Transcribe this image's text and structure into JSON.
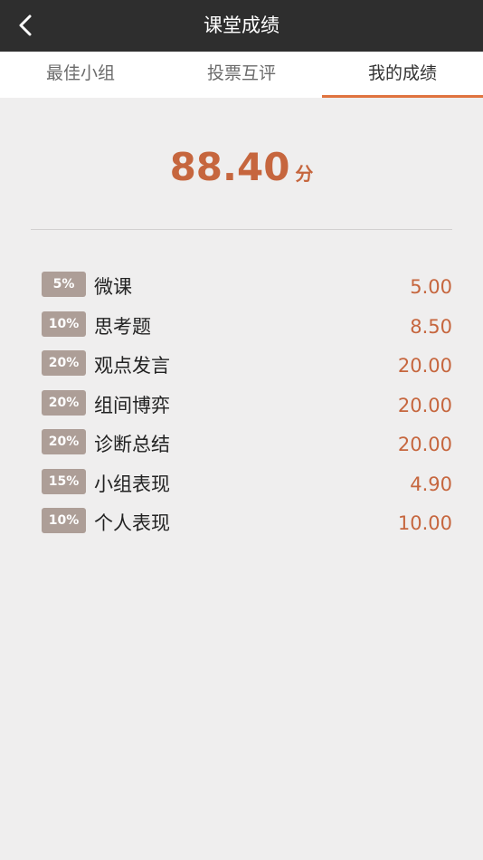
{
  "header": {
    "title": "课堂成绩",
    "back_icon": "chevron-left-icon"
  },
  "tabs": [
    {
      "label": "最佳小组",
      "active": false
    },
    {
      "label": "投票互评",
      "active": false
    },
    {
      "label": "我的成绩",
      "active": true
    }
  ],
  "score": {
    "value": "88.40",
    "unit": "分"
  },
  "colors": {
    "accent": "#e0743f",
    "score": "#c6663e",
    "badge": "#ad9e97",
    "header": "#2e2e2e"
  },
  "items": [
    {
      "weight": "5%",
      "label": "微课",
      "score": "5.00"
    },
    {
      "weight": "10%",
      "label": "思考题",
      "score": "8.50"
    },
    {
      "weight": "20%",
      "label": "观点发言",
      "score": "20.00"
    },
    {
      "weight": "20%",
      "label": "组间博弈",
      "score": "20.00"
    },
    {
      "weight": "20%",
      "label": "诊断总结",
      "score": "20.00"
    },
    {
      "weight": "15%",
      "label": "小组表现",
      "score": "4.90"
    },
    {
      "weight": "10%",
      "label": "个人表现",
      "score": "10.00"
    }
  ]
}
